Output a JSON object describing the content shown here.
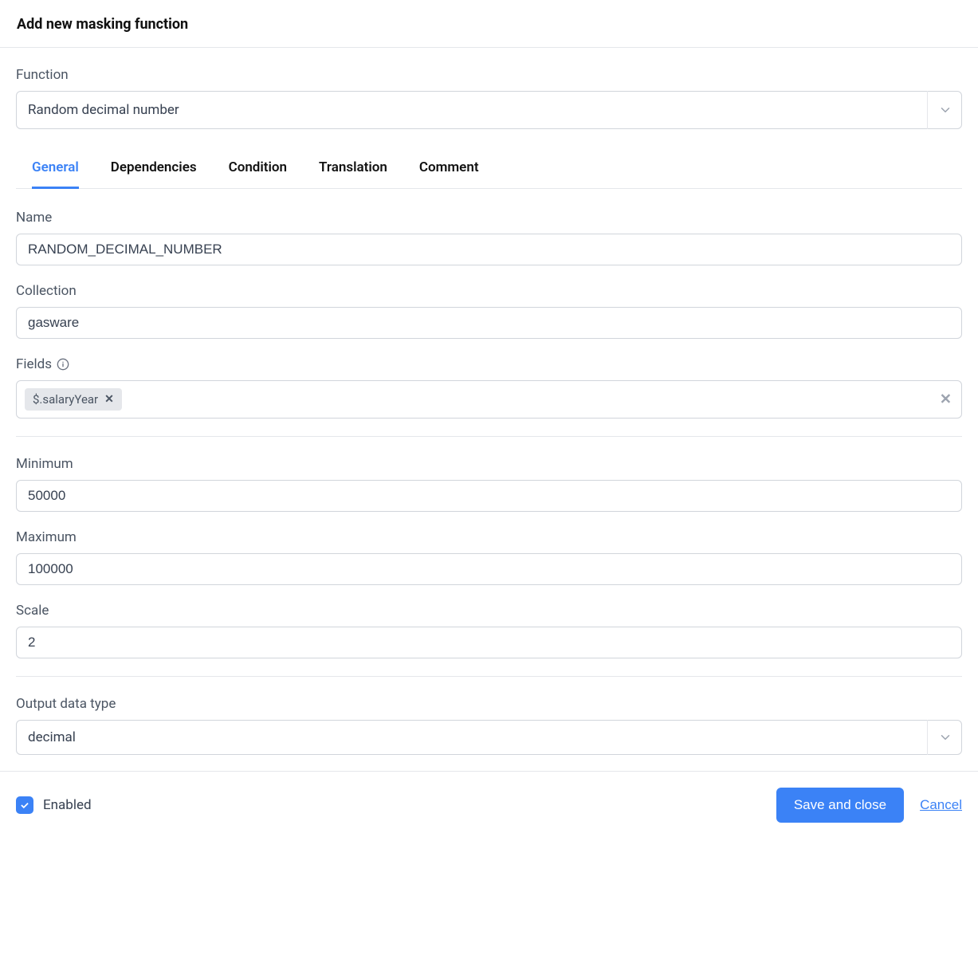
{
  "header": {
    "title": "Add new masking function"
  },
  "function": {
    "label": "Function",
    "value": "Random decimal number"
  },
  "tabs": [
    {
      "label": "General",
      "active": true
    },
    {
      "label": "Dependencies",
      "active": false
    },
    {
      "label": "Condition",
      "active": false
    },
    {
      "label": "Translation",
      "active": false
    },
    {
      "label": "Comment",
      "active": false
    }
  ],
  "form": {
    "name": {
      "label": "Name",
      "value": "RANDOM_DECIMAL_NUMBER"
    },
    "collection": {
      "label": "Collection",
      "value": "gasware"
    },
    "fields": {
      "label": "Fields",
      "tags": [
        "$.salaryYear"
      ]
    },
    "minimum": {
      "label": "Minimum",
      "value": "50000"
    },
    "maximum": {
      "label": "Maximum",
      "value": "100000"
    },
    "scale": {
      "label": "Scale",
      "value": "2"
    },
    "output_data_type": {
      "label": "Output data type",
      "value": "decimal"
    }
  },
  "footer": {
    "enabled_label": "Enabled",
    "enabled_checked": true,
    "save_label": "Save and close",
    "cancel_label": "Cancel"
  }
}
